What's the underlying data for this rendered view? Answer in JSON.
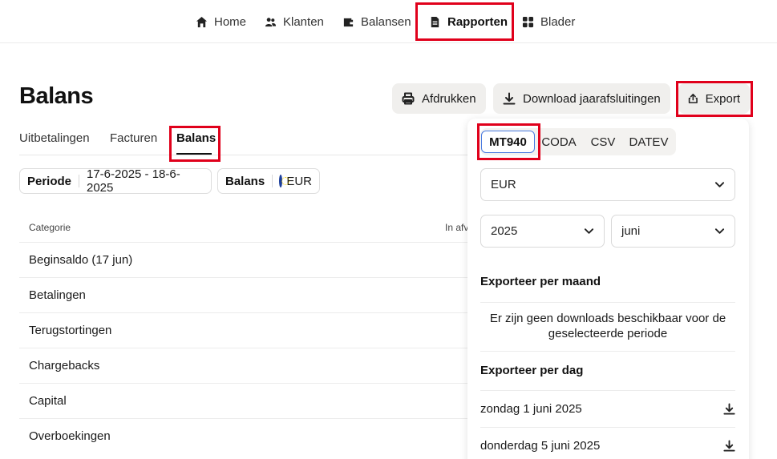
{
  "nav": {
    "items": [
      {
        "label": "Home",
        "icon": "home-icon"
      },
      {
        "label": "Klanten",
        "icon": "users-icon"
      },
      {
        "label": "Balansen",
        "icon": "wallet-icon"
      },
      {
        "label": "Rapporten",
        "icon": "document-icon",
        "active": true
      },
      {
        "label": "Blader",
        "icon": "grid-icon"
      }
    ]
  },
  "page": {
    "title": "Balans",
    "actions": {
      "print": "Afdrukken",
      "download": "Download jaarafsluitingen",
      "export": "Export"
    },
    "tabs": [
      "Uitbetalingen",
      "Facturen",
      "Balans"
    ],
    "active_tab": "Balans",
    "filters": {
      "period_label": "Periode",
      "period_value": "17-6-2025 - 18-6-2025",
      "balance_label": "Balans",
      "balance_value": "EUR"
    },
    "table": {
      "headers": [
        "Categorie",
        "In afv"
      ],
      "rows": [
        "Beginsaldo  (17 jun)",
        "Betalingen",
        "Terugstortingen",
        "Chargebacks",
        "Capital",
        "Overboekingen"
      ]
    }
  },
  "export_panel": {
    "formats": [
      "MT940",
      "CODA",
      "CSV",
      "DATEV"
    ],
    "selected_format": "MT940",
    "currency": "EUR",
    "year": "2025",
    "month": "juni",
    "per_month_title": "Exporteer per maand",
    "empty_message": "Er zijn geen downloads beschikbaar voor de geselecteerde periode",
    "per_day_title": "Exporteer per dag",
    "days": [
      "zondag 1 juni 2025",
      "donderdag 5 juni 2025"
    ]
  },
  "colors": {
    "highlight": "#e0001b",
    "accent_border": "#4a7be0",
    "button_bg": "#f0efed"
  }
}
